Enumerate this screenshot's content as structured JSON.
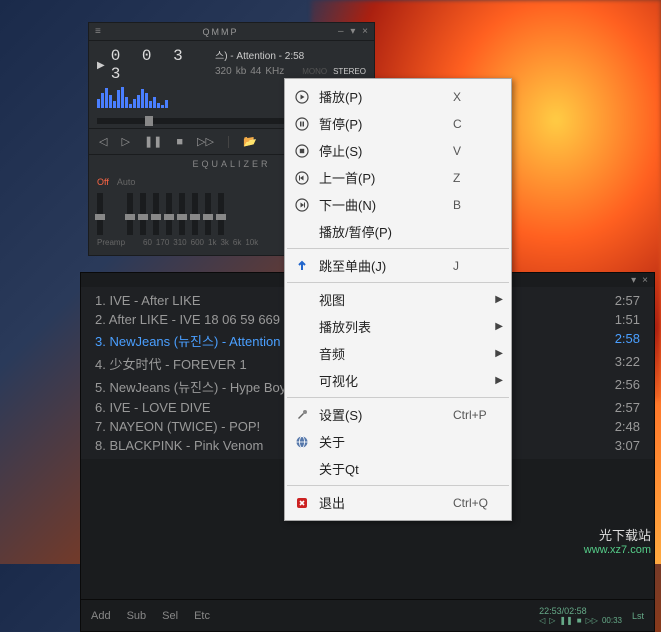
{
  "player": {
    "app_title": "QMMP",
    "timecode": "0 0 3 3",
    "now_playing": "스) - Attention - 2:58",
    "bitrate": "320",
    "bitrate_unit": "kb",
    "samplerate": "44",
    "samplerate_unit": "KHz",
    "mono": "MONO",
    "stereo": "STEREO",
    "controls": {
      "prev": "◁",
      "play": "▷",
      "pause": "❚❚",
      "stop": "■",
      "next": "▷▷",
      "open": "📂"
    }
  },
  "equalizer": {
    "title": "EQUALIZER",
    "off": "Off",
    "auto": "Auto",
    "preamp": "Preamp",
    "bands": [
      "60",
      "170",
      "310",
      "600",
      "1k",
      "3k",
      "6k",
      "10k"
    ]
  },
  "playlist": {
    "items": [
      {
        "n": "1",
        "title": "IVE - After LIKE",
        "dur": "2:57"
      },
      {
        "n": "2",
        "title": "After LIKE - IVE 18 06 59 669",
        "dur": "1:51"
      },
      {
        "n": "3",
        "title": "NewJeans (뉴진스) - Attention",
        "dur": "2:58"
      },
      {
        "n": "4",
        "title": "少女时代 - FOREVER 1",
        "dur": "3:22"
      },
      {
        "n": "5",
        "title": "NewJeans (뉴진스) - Hype Boy",
        "dur": "2:56"
      },
      {
        "n": "6",
        "title": "IVE - LOVE DIVE",
        "dur": "2:57"
      },
      {
        "n": "7",
        "title": "NAYEON (TWICE) - POP!",
        "dur": "2:48"
      },
      {
        "n": "8",
        "title": "BLACKPINK - Pink Venom",
        "dur": "3:07"
      }
    ],
    "footer": {
      "add": "Add",
      "sub": "Sub",
      "sel": "Sel",
      "etc": "Etc",
      "time": "22:53/02:58",
      "elapsed": "00:33",
      "lst": "Lst"
    }
  },
  "context_menu": {
    "items": [
      {
        "icon": "play",
        "label": "播放(P)",
        "shortcut": "X"
      },
      {
        "icon": "pause",
        "label": "暂停(P)",
        "shortcut": "C"
      },
      {
        "icon": "stop",
        "label": "停止(S)",
        "shortcut": "V"
      },
      {
        "icon": "prev",
        "label": "上一首(P)",
        "shortcut": "Z"
      },
      {
        "icon": "next",
        "label": "下一曲(N)",
        "shortcut": "B"
      },
      {
        "icon": "",
        "label": "播放/暂停(P)",
        "shortcut": ""
      },
      {
        "sep": true
      },
      {
        "icon": "jump",
        "label": "跳至单曲(J)",
        "shortcut": "J"
      },
      {
        "sep": true
      },
      {
        "icon": "",
        "label": "视图",
        "submenu": true
      },
      {
        "icon": "",
        "label": "播放列表",
        "submenu": true
      },
      {
        "icon": "",
        "label": "音频",
        "submenu": true
      },
      {
        "icon": "",
        "label": "可视化",
        "submenu": true
      },
      {
        "sep": true
      },
      {
        "icon": "settings",
        "label": "设置(S)",
        "shortcut": "Ctrl+P"
      },
      {
        "icon": "globe",
        "label": "关于",
        "shortcut": ""
      },
      {
        "icon": "",
        "label": "关于Qt",
        "shortcut": ""
      },
      {
        "sep": true
      },
      {
        "icon": "quit",
        "label": "退出",
        "shortcut": "Ctrl+Q"
      }
    ]
  },
  "watermark": {
    "cn": "光下载站",
    "url": "www.xz7.com"
  }
}
